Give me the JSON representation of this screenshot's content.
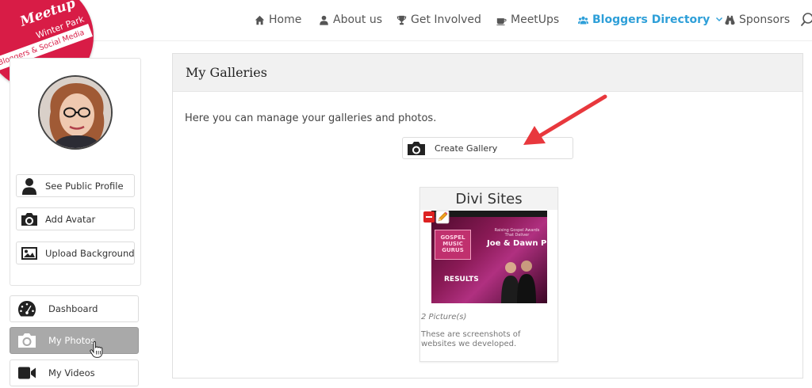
{
  "logo": {
    "brand": "Meetup",
    "place": "Winter Park",
    "banner": "Bloggers & Social Media"
  },
  "nav": {
    "items": [
      {
        "label": "Home",
        "icon": "home-icon"
      },
      {
        "label": "About us",
        "icon": "user-icon"
      },
      {
        "label": "Get Involved",
        "icon": "trophy-icon"
      },
      {
        "label": "MeetUps",
        "icon": "coffee-icon"
      },
      {
        "label": "Bloggers Directory",
        "icon": "users-icon",
        "active": true
      },
      {
        "label": "Sponsors",
        "icon": "binoculars-icon"
      }
    ]
  },
  "sidebar": {
    "profile_buttons": [
      {
        "label": "See Public Profile",
        "icon": "user-icon"
      },
      {
        "label": "Add Avatar",
        "icon": "camera-icon"
      },
      {
        "label": "Upload Background",
        "icon": "image-icon"
      }
    ],
    "menu": [
      {
        "label": "Dashboard",
        "icon": "dashboard-icon"
      },
      {
        "label": "My Photos",
        "icon": "camera-icon",
        "selected": true
      },
      {
        "label": "My Videos",
        "icon": "video-camera-icon"
      }
    ]
  },
  "main": {
    "title": "My Galleries",
    "description": "Here you can manage your galleries and photos.",
    "create_label": "Create Gallery",
    "gallery": {
      "title": "Divi Sites",
      "count": "2 Picture(s)",
      "description": "These are screenshots of websites we developed.",
      "thumb_logo": "GOSPEL MUSIC GURUS",
      "thumb_results": "RESULTS",
      "thumb_tag": "Raising Gospel Awards That Deliver",
      "thumb_names": "Joe & Dawn Pici"
    }
  },
  "colors": {
    "accent": "#2e9fd8",
    "logo_red": "#d81c46",
    "arrow_red": "#e8383d",
    "selected_gray": "#a9a9a9"
  }
}
